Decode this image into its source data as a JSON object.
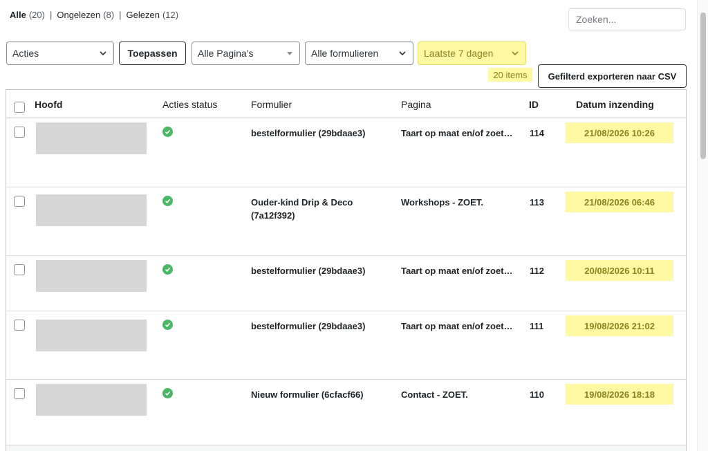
{
  "status_filters": {
    "all": {
      "label": "Alle",
      "count": "(20)"
    },
    "unread": {
      "label": "Ongelezen",
      "count": "(8)"
    },
    "read": {
      "label": "Gelezen",
      "count": "(12)"
    },
    "separator": "|"
  },
  "search": {
    "placeholder": "Zoeken..."
  },
  "toolbar": {
    "bulk_actions": "Acties",
    "apply_label": "Toepassen",
    "pages_filter": "Alle Pagina's",
    "forms_filter": "Alle formulieren",
    "date_filter": "Laatste 7 dagen",
    "items_count": "20 items",
    "export_label": "Gefilterd exporteren naar CSV"
  },
  "table": {
    "columns": {
      "main": "Hoofd",
      "actions_status": "Acties status",
      "form": "Formulier",
      "page": "Pagina",
      "id": "ID",
      "date": "Datum inzending"
    },
    "rows": [
      {
        "form": "bestelformulier (29bdaae3)",
        "page": "Taart op maat en/of zoet…",
        "id": "114",
        "date": "21/08/2026 10:26"
      },
      {
        "form": "Ouder-kind Drip & Deco (7a12f392)",
        "page": "Workshops - ZOET.",
        "id": "113",
        "date": "21/08/2026 06:46"
      },
      {
        "form": "bestelformulier (29bdaae3)",
        "page": "Taart op maat en/of zoet…",
        "id": "112",
        "date": "20/08/2026 10:11"
      },
      {
        "form": "bestelformulier (29bdaae3)",
        "page": "Taart op maat en/of zoet…",
        "id": "111",
        "date": "19/08/2026 21:02"
      },
      {
        "form": "Nieuw formulier (6cfacf66)",
        "page": "Contact - ZOET.",
        "id": "110",
        "date": "19/08/2026 18:18"
      }
    ]
  },
  "colors": {
    "highlight": "#fff9a3",
    "success": "#4ab866"
  }
}
